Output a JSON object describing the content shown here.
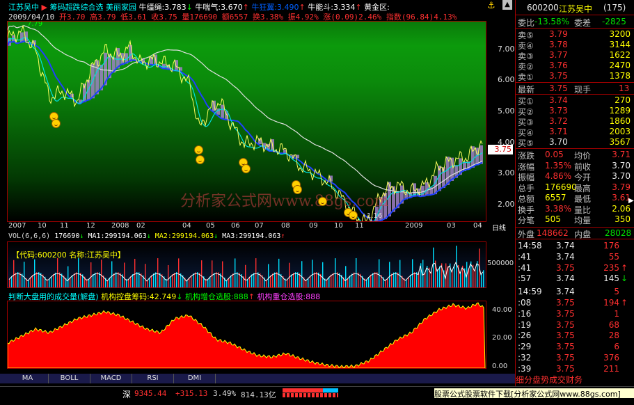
{
  "header": {
    "stock_name": "江苏吴中",
    "indicator_name": "筹码超跌综合选 美丽家园",
    "niu_jiang_sheng": "牛缰绳:3.783",
    "niu_chuan_qi": "牛喘气:3.670",
    "niu_kuang_wen": "牛狂翼:3.490",
    "niu_neng_dou": "牛能斗:3.334",
    "huang_jin_qu": "黄金区:",
    "date": "2009/04/10",
    "open": "开3.70",
    "high": "高3.79",
    "low": "低3.61",
    "close": "收3.75",
    "volume": "量176690",
    "amount": "额6557",
    "turnover": "换3.38%",
    "amplitude": "振4.92%",
    "change": "涨(0.09)2.46%",
    "index": "指数(96.84)4.13%"
  },
  "price_axis": [
    "7.00",
    "6.00",
    "5.00",
    "4.00",
    "3.00",
    "2.00"
  ],
  "current_price_tag": "3.75",
  "top_price_label": "7.79",
  "low_price_label": "1.16",
  "time_axis": [
    "2007",
    "10",
    "11",
    "12",
    "2008",
    "02",
    "04",
    "05",
    "06",
    "07",
    "08",
    "09",
    "10",
    "11",
    "2009",
    "03",
    "04"
  ],
  "period_label": "日线",
  "watermark": "分析家公式网www.88gs.com",
  "vol": {
    "header": "VOL(6,6,6)",
    "value": "176690",
    "ma1": "MA1:299194.063",
    "ma2": "MA2:299194.063",
    "ma3": "MA3:299194.063",
    "info": "【代码:600200 名称:江苏吴中】",
    "axis": "500000"
  },
  "indicator": {
    "title": "判断大盘用的成交量(解盘)",
    "chip": "机构控盘筹码:42.749",
    "add": "机构增仓选股:888",
    "heavy": "机构重仓选股:888",
    "axis": [
      "40.00",
      "20.00",
      "0.00"
    ]
  },
  "tabs": [
    "MA",
    "BOLL",
    "MACD",
    "RSI",
    "DMI"
  ],
  "status": {
    "market": "深",
    "index_value": "9345.44",
    "index_change": "+315.13",
    "index_pct": "3.49%",
    "turnover": "814.13亿",
    "ad_text": "股票公式股票软件下载[分析家公式网www.88gs.com]"
  },
  "panel": {
    "code": "600200",
    "name": "江苏吴中",
    "rank": "(175)",
    "weibi_label": "委比",
    "weibi": "-13.58%",
    "weicha_label": "委差",
    "weicha": "-2825",
    "asks": [
      {
        "label": "卖⑤",
        "price": "3.79",
        "vol": "3200"
      },
      {
        "label": "卖④",
        "price": "3.78",
        "vol": "3144"
      },
      {
        "label": "卖③",
        "price": "3.77",
        "vol": "1622"
      },
      {
        "label": "卖②",
        "price": "3.76",
        "vol": "2470"
      },
      {
        "label": "卖①",
        "price": "3.75",
        "vol": "1378"
      }
    ],
    "latest_label": "最新",
    "latest": "3.75",
    "hand_label": "现手",
    "hand": "13",
    "bids": [
      {
        "label": "买①",
        "price": "3.74",
        "vol": "270"
      },
      {
        "label": "买②",
        "price": "3.73",
        "vol": "1289"
      },
      {
        "label": "买③",
        "price": "3.72",
        "vol": "1860"
      },
      {
        "label": "买④",
        "price": "3.71",
        "vol": "2003"
      },
      {
        "label": "买⑤",
        "price": "3.70",
        "vol": "3567"
      }
    ],
    "stats": [
      {
        "l1": "涨跌",
        "v1": "0.05",
        "l2": "均价",
        "v2": "3.71"
      },
      {
        "l1": "涨幅",
        "v1": "1.35%",
        "l2": "前收",
        "v2": "3.70"
      },
      {
        "l1": "振幅",
        "v1": "4.86%",
        "l2": "今开",
        "v2": "3.70"
      },
      {
        "l1": "总手",
        "v1": "176690",
        "l2": "最高",
        "v2": "3.79"
      },
      {
        "l1": "总额",
        "v1": "6557",
        "l2": "最低",
        "v2": "3.61"
      },
      {
        "l1": "换手",
        "v1": "3.38%",
        "l2": "量比",
        "v2": "2.06"
      },
      {
        "l1": "分笔",
        "v1": "505",
        "l2": "均量",
        "v2": "350"
      }
    ],
    "outer_label": "外盘",
    "outer": "148662",
    "inner_label": "内盘",
    "inner": "28028",
    "ticks": [
      {
        "t": "14:58",
        "p": "3.74",
        "v": "176",
        "d": ""
      },
      {
        "t": ":41",
        "p": "3.74",
        "v": "55",
        "d": ""
      },
      {
        "t": ":41",
        "p": "3.75",
        "v": "235",
        "d": "↑"
      },
      {
        "t": ":57",
        "p": "3.74",
        "v": "145",
        "d": "↓"
      },
      {
        "t": "14:59",
        "p": "3.74",
        "v": "5",
        "d": ""
      },
      {
        "t": ":08",
        "p": "3.75",
        "v": "194",
        "d": "↑"
      },
      {
        "t": ":16",
        "p": "3.75",
        "v": "1",
        "d": ""
      },
      {
        "t": ":19",
        "p": "3.75",
        "v": "68",
        "d": ""
      },
      {
        "t": ":26",
        "p": "3.75",
        "v": "28",
        "d": ""
      },
      {
        "t": ":29",
        "p": "3.75",
        "v": "6",
        "d": ""
      },
      {
        "t": ":32",
        "p": "3.75",
        "v": "376",
        "d": ""
      },
      {
        "t": ":39",
        "p": "3.75",
        "v": "211",
        "d": ""
      }
    ],
    "footer": "细分盘势成交财务"
  }
}
